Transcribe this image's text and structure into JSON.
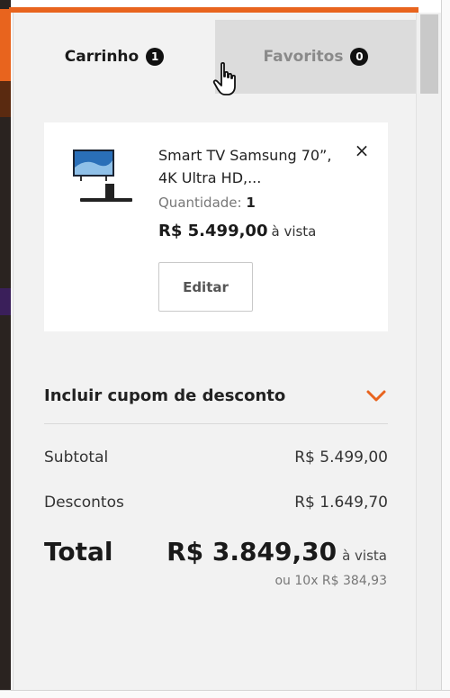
{
  "tabs": {
    "cart_label": "Carrinho",
    "cart_count": "1",
    "favorites_label": "Favoritos",
    "favorites_count": "0"
  },
  "product": {
    "name_line1": "Smart TV Samsung 70”,",
    "name_line2": "4K Ultra HD,...",
    "quantity_label": "Quantidade:",
    "quantity_value": "1",
    "price": "R$ 5.499,00",
    "price_suffix": "à vista",
    "edit_label": "Editar",
    "remove_icon": "×"
  },
  "coupon": {
    "label": "Incluir cupom de desconto"
  },
  "summary": {
    "subtotal_label": "Subtotal",
    "subtotal_value": "R$ 5.499,00",
    "discount_label": "Descontos",
    "discount_value": "R$ 1.649,70",
    "total_label": "Total",
    "total_value": "R$ 3.849,30",
    "total_suffix": "à vista",
    "installments": "ou 10x R$ 384,93"
  },
  "colors": {
    "accent": "#e8641e",
    "badge": "#111111",
    "panel_bg": "#f2f2f2"
  }
}
